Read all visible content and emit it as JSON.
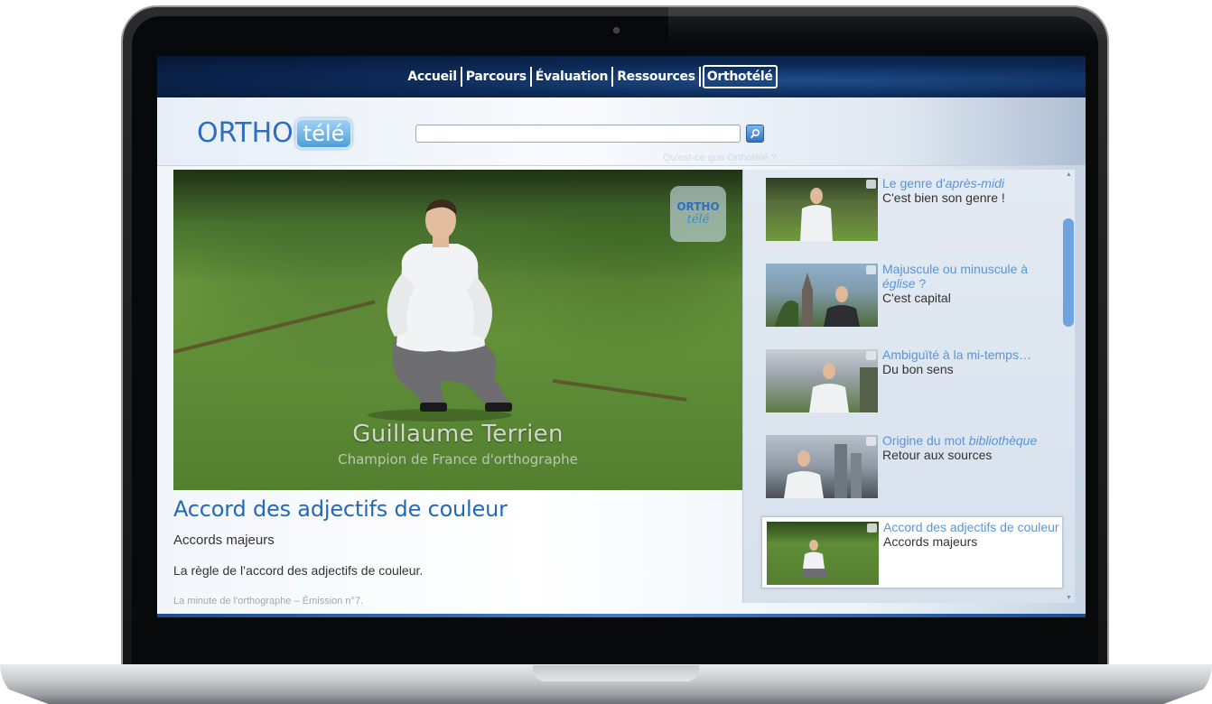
{
  "nav": {
    "items": [
      {
        "label": "Accueil"
      },
      {
        "label": "Parcours"
      },
      {
        "label": "Évaluation"
      },
      {
        "label": "Ressources"
      },
      {
        "label": "Orthotélé"
      }
    ],
    "active_index": 4
  },
  "logo": {
    "part1": "ORTHO",
    "part2": "télé"
  },
  "search": {
    "value": "",
    "placeholder": "",
    "button_icon": "magnifier-icon"
  },
  "ghost_text": "Qu'est-ce que Orthotélé ?",
  "video": {
    "overlay_logo_top": "ORTHO",
    "overlay_logo_bottom": "télé",
    "caption_name": "Guillaume Terrien",
    "caption_role": "Champion de France d'orthographe"
  },
  "episode": {
    "title": "Accord des adjectifs de couleur",
    "subtitle": "Accords majeurs",
    "description": "La règle de l’accord des adjectifs de couleur.",
    "meta": "La minute de l'orthographe – Émission n°7."
  },
  "playlist": [
    {
      "title_prefix": "Le genre d'",
      "title_italic": "après-midi",
      "title_suffix": "",
      "subtitle": "C'est bien son genre !",
      "active": false
    },
    {
      "title_prefix": "Majuscule ou minuscule à ",
      "title_italic": "église",
      "title_suffix": " ?",
      "subtitle": "C'est capital",
      "active": false
    },
    {
      "title_prefix": "Ambiguïté à la mi-temps…",
      "title_italic": "",
      "title_suffix": "",
      "subtitle": "Du bon sens",
      "active": false
    },
    {
      "title_prefix": "Origine du mot ",
      "title_italic": "bibliothèque",
      "title_suffix": "",
      "subtitle": "Retour aux sources",
      "active": false
    },
    {
      "title_prefix": "Accord des adjectifs de couleur",
      "title_italic": "",
      "title_suffix": "",
      "subtitle": "Accords majeurs",
      "active": true
    }
  ],
  "colors": {
    "accent_blue": "#2369b8",
    "link_blue": "#5a95d6",
    "nav_bg": "#0d2a58",
    "scroll_thumb": "#6ea3df"
  }
}
